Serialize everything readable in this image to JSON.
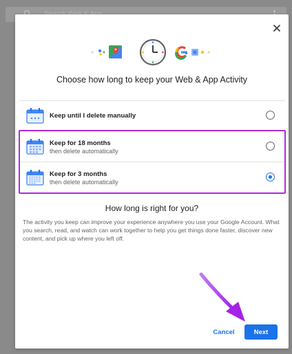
{
  "background": {
    "search_placeholder": "Search Web & App"
  },
  "dialog": {
    "title": "Choose how long to keep your Web & App Activity",
    "options": [
      {
        "label": "Keep until I delete manually",
        "sublabel": "",
        "selected": false
      },
      {
        "label": "Keep for 18 months",
        "sublabel": "then delete automatically",
        "selected": false
      },
      {
        "label": "Keep for 3 months",
        "sublabel": "then delete automatically",
        "selected": true
      }
    ],
    "section_title": "How long is right for you?",
    "section_body": "The activity you keep can improve your experience anywhere you use your Google Account. What you search, read, and watch can work together to help you get things done faster, discover new content, and pick up where you left off.",
    "cancel_label": "Cancel",
    "next_label": "Next"
  },
  "colors": {
    "accent": "#1a73e8",
    "highlight": "#b02ad8",
    "arrow": "#b322e0"
  },
  "icons": {
    "close": "close-icon",
    "clock": "clock-icon",
    "calendar": "calendar-icon",
    "arrow": "arrow-annotation"
  }
}
